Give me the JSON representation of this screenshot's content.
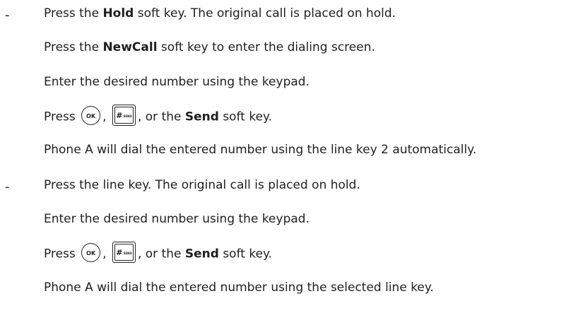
{
  "dash": "-",
  "section1": {
    "line1": {
      "prefix": "Press the ",
      "bold": "Hold",
      "suffix": " soft key. The original call is placed on hold."
    },
    "line2": {
      "prefix": "Press the ",
      "bold": "NewCall",
      "suffix": " soft key to enter the dialing screen."
    },
    "line3": "Enter the desired number using the keypad.",
    "line4": {
      "press": "Press",
      "comma": ",",
      "suffix": ", or the ",
      "bold": "Send",
      "tail": " soft key."
    },
    "line5": "Phone A will dial the entered number using the line key 2 automatically."
  },
  "section2": {
    "line1": "Press the line key. The original call is placed on hold.",
    "line2": "Enter the desired number using the keypad.",
    "line3": {
      "press": "Press",
      "comma": ",",
      "suffix": ", or the ",
      "bold": "Send",
      "tail": " soft key."
    },
    "line4": "Phone A will dial the entered number using the selected line key."
  },
  "keys": {
    "ok": "OK",
    "hash": "#",
    "hash_sub": "SEND"
  }
}
